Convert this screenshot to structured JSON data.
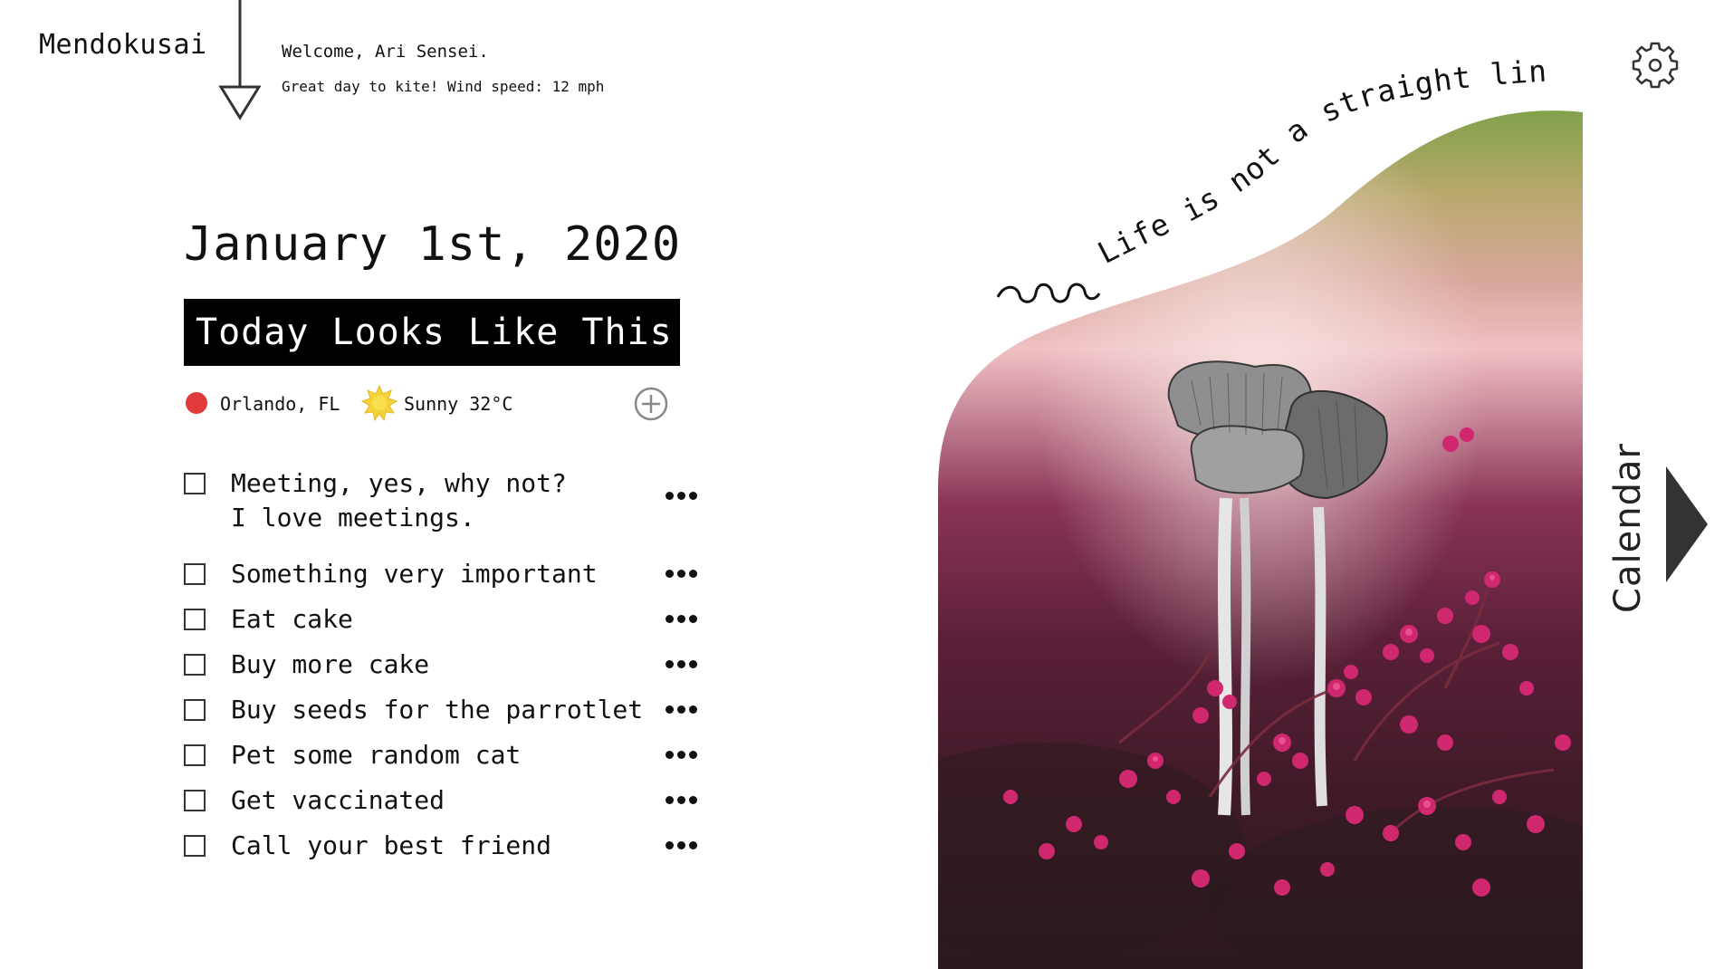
{
  "app": {
    "brand": "Mendokusai"
  },
  "header": {
    "welcome": "Welcome, Ari Sensei.",
    "weather_note": "Great day to kite! Wind speed: 12 mph"
  },
  "main": {
    "date": "January 1st, 2020",
    "banner": "Today Looks Like This:",
    "location": "Orlando, FL",
    "weather": "Sunny 32°C",
    "todos": [
      {
        "text": "Meeting, yes, why not?\nI love meetings."
      },
      {
        "text": "Something very important"
      },
      {
        "text": "Eat cake"
      },
      {
        "text": "Buy more cake"
      },
      {
        "text": "Buy seeds for the parrotlet"
      },
      {
        "text": "Pet some random cat"
      },
      {
        "text": "Get vaccinated"
      },
      {
        "text": "Call your best friend"
      }
    ]
  },
  "quote": "Life is not a straight line",
  "side_tab": {
    "label": "Calendar"
  },
  "colors": {
    "location_dot": "#e03a3a",
    "banner_bg": "#000000",
    "sun": "#f4d23a"
  },
  "icons": [
    "down-arrow-icon",
    "gear-icon",
    "location-dot-icon",
    "sun-icon",
    "add-icon",
    "more-icon",
    "chevron-right-icon"
  ]
}
